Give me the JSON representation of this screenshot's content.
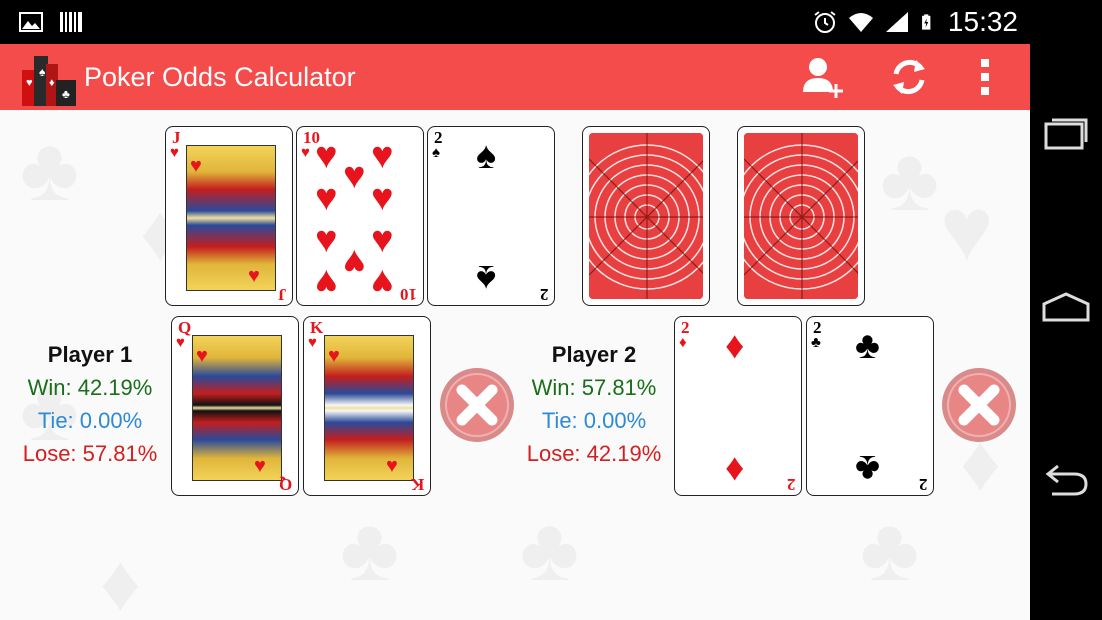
{
  "status_bar": {
    "time": "15:32"
  },
  "app_bar": {
    "title": "Poker Odds Calculator",
    "actions": [
      "add-player",
      "refresh",
      "overflow-menu"
    ]
  },
  "board": {
    "cards": [
      {
        "rank": "J",
        "suit": "♥",
        "color": "#e8141d"
      },
      {
        "rank": "10",
        "suit": "♥",
        "color": "#e8141d"
      },
      {
        "rank": "2",
        "suit": "♠",
        "color": "#000000"
      }
    ],
    "empty_slots": 2
  },
  "players": [
    {
      "name": "Player 1",
      "win": "Win: 42.19%",
      "tie": "Tie: 0.00%",
      "lose": "Lose: 57.81%",
      "cards": [
        {
          "rank": "Q",
          "suit": "♥"
        },
        {
          "rank": "K",
          "suit": "♥"
        }
      ]
    },
    {
      "name": "Player 2",
      "win": "Win: 57.81%",
      "tie": "Tie: 0.00%",
      "lose": "Lose: 42.19%",
      "cards": [
        {
          "rank": "2",
          "suit": "♦"
        },
        {
          "rank": "2",
          "suit": "♣"
        }
      ]
    }
  ],
  "colors": {
    "accent": "#f44b4b",
    "win": "#1a6e1a",
    "tie": "#2d8ad6",
    "lose": "#d31f1f"
  }
}
